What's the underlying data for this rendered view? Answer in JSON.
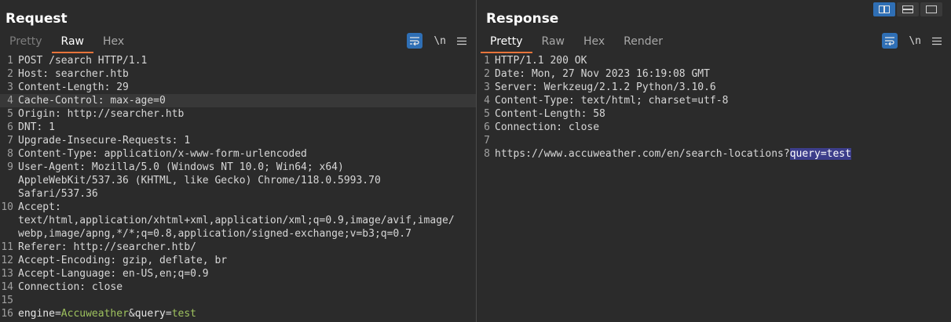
{
  "request": {
    "title": "Request",
    "tabs": [
      "Pretty",
      "Raw",
      "Hex"
    ],
    "active_tab": "Raw",
    "wrap_icon": "wrap-lines-icon",
    "newline_label": "\\n",
    "menu_icon": "hamburger-menu-icon",
    "lines": [
      {
        "num": "1",
        "text": "POST /search HTTP/1.1"
      },
      {
        "num": "2",
        "text": "Host: searcher.htb"
      },
      {
        "num": "3",
        "text": "Content-Length: 29"
      },
      {
        "num": "4",
        "text": "Cache-Control: max-age=0",
        "highlight": true
      },
      {
        "num": "5",
        "text": "Origin: http://searcher.htb"
      },
      {
        "num": "6",
        "text": "DNT: 1"
      },
      {
        "num": "7",
        "text": "Upgrade-Insecure-Requests: 1"
      },
      {
        "num": "8",
        "text": "Content-Type: application/x-www-form-urlencoded"
      },
      {
        "num": "9",
        "text": "User-Agent: Mozilla/5.0 (Windows NT 10.0; Win64; x64)",
        "cont": [
          "AppleWebKit/537.36 (KHTML, like Gecko) Chrome/118.0.5993.70",
          "Safari/537.36"
        ]
      },
      {
        "num": "10",
        "text": "Accept:",
        "cont": [
          "text/html,application/xhtml+xml,application/xml;q=0.9,image/avif,image/",
          "webp,image/apng,*/*;q=0.8,application/signed-exchange;v=b3;q=0.7"
        ]
      },
      {
        "num": "11",
        "text": "Referer: http://searcher.htb/"
      },
      {
        "num": "12",
        "text": "Accept-Encoding: gzip, deflate, br"
      },
      {
        "num": "13",
        "text": "Accept-Language: en-US,en;q=0.9"
      },
      {
        "num": "14",
        "text": "Connection: close"
      },
      {
        "num": "15",
        "text": ""
      },
      {
        "num": "16",
        "body": {
          "k1": "engine",
          "eq1": "=",
          "v1": "Accuweather",
          "amp": "&",
          "k2": "query",
          "eq2": "=",
          "v2": "test"
        }
      }
    ]
  },
  "response": {
    "title": "Response",
    "tabs": [
      "Pretty",
      "Raw",
      "Hex",
      "Render"
    ],
    "active_tab": "Pretty",
    "newline_label": "\\n",
    "lines": [
      {
        "num": "1",
        "text": "HTTP/1.1 200 OK"
      },
      {
        "num": "2",
        "text": "Date: Mon, 27 Nov 2023 16:19:08 GMT"
      },
      {
        "num": "3",
        "text": "Server: Werkzeug/2.1.2 Python/3.10.6"
      },
      {
        "num": "4",
        "text": "Content-Type: text/html; charset=utf-8"
      },
      {
        "num": "5",
        "text": "Content-Length: 58"
      },
      {
        "num": "6",
        "text": "Connection: close"
      },
      {
        "num": "7",
        "text": ""
      },
      {
        "num": "8",
        "url_prefix": "https://www.accuweather.com/en/search-locations?",
        "url_selected": "query=test"
      }
    ]
  },
  "layout_buttons": [
    "side-by-side-layout-icon",
    "top-bottom-layout-icon",
    "single-pane-layout-icon"
  ],
  "colors": {
    "accent_tab": "#e8743b",
    "button_blue": "#2f6fb5",
    "param_value_green": "#9ec25e",
    "selection": "#3c3d8a"
  }
}
